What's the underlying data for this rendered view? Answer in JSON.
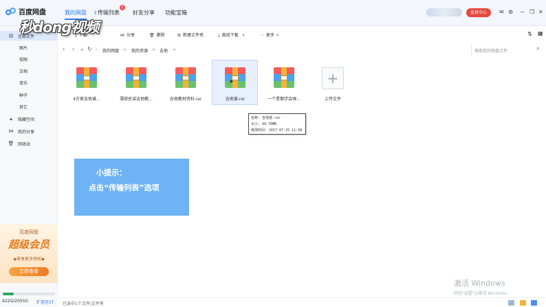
{
  "topbar": {
    "logo_text": "百度网盘",
    "tabs": [
      {
        "label": "我的网盘",
        "active": true
      },
      {
        "label": "传输列表",
        "badge": "1"
      },
      {
        "label": "好友分享"
      },
      {
        "label": "功能宝箱"
      }
    ],
    "vip_label": "会员中心",
    "icons": [
      "mail-icon",
      "gear-icon",
      "minimize-icon",
      "restore-icon",
      "close-icon"
    ]
  },
  "watermark": "秒dong视频",
  "sidebar": {
    "items": [
      {
        "label": "全部文件",
        "icon": "file-icon"
      },
      {
        "label": "图片"
      },
      {
        "label": "视频"
      },
      {
        "label": "文档"
      },
      {
        "label": "音乐"
      },
      {
        "label": "种子"
      },
      {
        "label": "其它"
      },
      {
        "label": "隐藏空间",
        "icon": "lock-icon"
      },
      {
        "label": "我的分享",
        "icon": "share-icon"
      },
      {
        "label": "回收站",
        "icon": "trash-icon"
      }
    ],
    "promo": {
      "brand": "百度网盘",
      "title": "超级会员",
      "subtitle": "◆尊享更多特权◆",
      "button": "立即查看"
    },
    "storage": {
      "used": "422G/2055G",
      "expand_label": "扩容至5T",
      "fill_fraction": 0.21
    }
  },
  "toolbar": {
    "items": [
      {
        "label": "下载",
        "icon": "download-icon"
      },
      {
        "label": "分享",
        "icon": "share-icon"
      },
      {
        "label": "删除",
        "icon": "trash-icon"
      },
      {
        "label": "新建文件夹",
        "icon": "new-folder-icon"
      },
      {
        "label": "离线下载",
        "icon": "offline-download-icon"
      },
      {
        "label": "更多",
        "icon": "more-icon"
      }
    ]
  },
  "address": {
    "breadcrumb": [
      "我的网盘",
      "我的资源",
      "吉他"
    ],
    "search_placeholder": "搜索我的网盘文件"
  },
  "files": [
    {
      "name": "4万首吉他谱..."
    },
    {
      "name": "薄荷民谣吉他教..."
    },
    {
      "name": "吉他教材资料.rar"
    },
    {
      "name": "吉他谱.rar",
      "selected": true
    },
    {
      "name": "一个星期学会弹..."
    },
    {
      "name": "上传文件",
      "upload": true
    }
  ],
  "tooltip": {
    "name": "名称: 吉他谱.rar",
    "size": "大小: 94.78MB",
    "modified": "修改时间: 2017-07-25 11:58"
  },
  "hint": {
    "title": "小提示：",
    "body": "点击“传输列表”选项"
  },
  "windows_activation": {
    "line1": "激活 Windows",
    "line2": "转到\"设置\"以激活 Windows。"
  },
  "statusbar": {
    "text": "已选中1个文件/文件夹"
  }
}
